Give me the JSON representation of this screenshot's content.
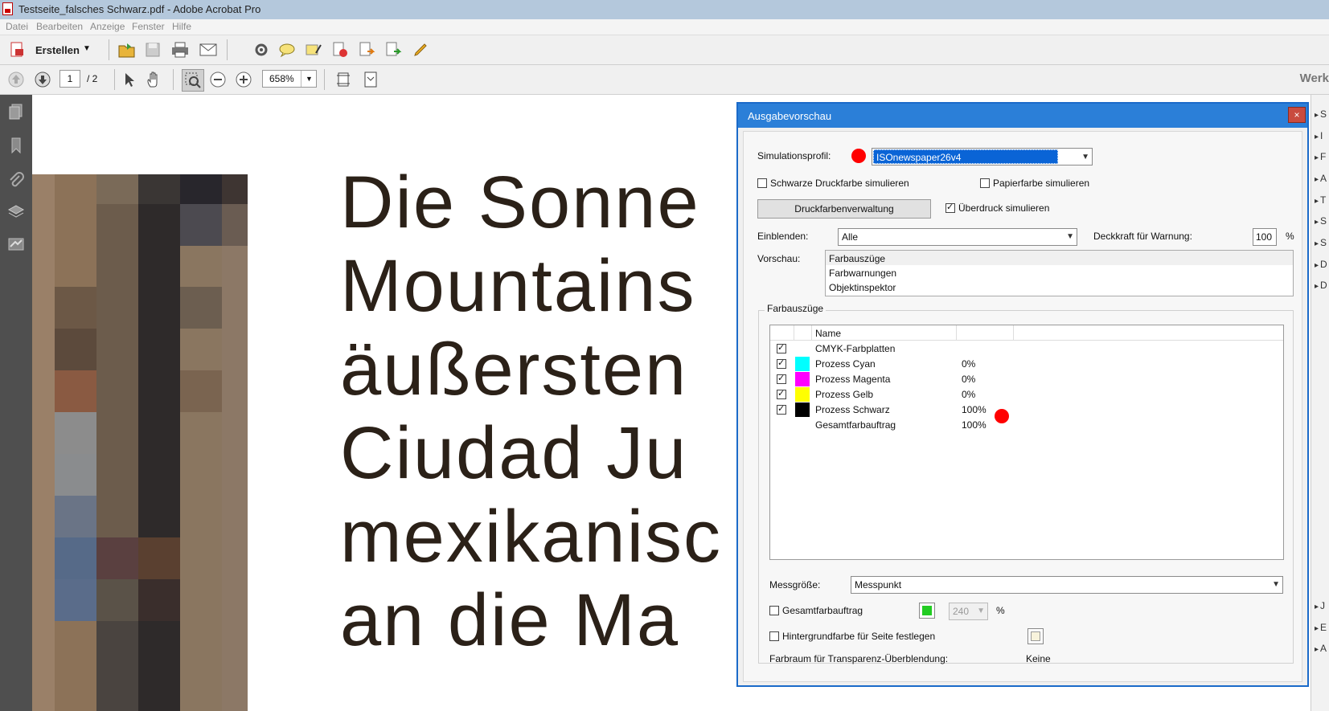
{
  "window": {
    "title": "Testseite_falsches Schwarz.pdf - Adobe Acrobat Pro"
  },
  "menu": [
    "Datei",
    "Bearbeiten",
    "Anzeige",
    "Fenster",
    "Hilfe"
  ],
  "toolbar": {
    "create_label": "Erstellen"
  },
  "navigation": {
    "current_page": "1",
    "total_pages": "/ 2",
    "zoom": "658%",
    "tools_label": "Werk"
  },
  "document": {
    "lines": [
      "Die Sonne",
      "Mountains",
      "äußersten",
      "Ciudad Ju",
      "mexikanisc",
      "an die Ma"
    ]
  },
  "right_pane_items": [
    "S",
    "I",
    "F",
    "A",
    "T",
    "S",
    "S",
    "D",
    "D",
    "J",
    "E",
    "A"
  ],
  "dialog": {
    "title": "Ausgabevorschau",
    "close": "×",
    "simulation_profile_label": "Simulationsprofil:",
    "simulation_profile_value": "ISOnewspaper26v4",
    "black_ink_label": "Schwarze Druckfarbe simulieren",
    "paper_color_label": "Papierfarbe simulieren",
    "ink_manager_button": "Druckfarbenverwaltung",
    "overprint_label": "Überdruck simulieren",
    "show_label": "Einblenden:",
    "show_value": "Alle",
    "warning_opacity_label": "Deckkraft für Warnung:",
    "warning_opacity_value": "100",
    "percent": "%",
    "preview_label": "Vorschau:",
    "preview_options": [
      "Farbauszüge",
      "Farbwarnungen",
      "Objektinspektor"
    ],
    "separations_group_label": "Farbauszüge",
    "table_header_name": "Name",
    "separations": [
      {
        "name": "CMYK-Farbplatten",
        "value": "",
        "swatch": "",
        "checked": true
      },
      {
        "name": "Prozess Cyan",
        "value": "0%",
        "swatch": "#00ffff",
        "checked": true
      },
      {
        "name": "Prozess Magenta",
        "value": "0%",
        "swatch": "#ff00ff",
        "checked": true
      },
      {
        "name": "Prozess Gelb",
        "value": "0%",
        "swatch": "#ffff00",
        "checked": true
      },
      {
        "name": "Prozess Schwarz",
        "value": "100%",
        "swatch": "#000000",
        "checked": true
      },
      {
        "name": "Gesamtfarbauftrag",
        "value": "100%",
        "swatch": "",
        "checked": false
      }
    ],
    "sample_size_label": "Messgröße:",
    "sample_size_value": "Messpunkt",
    "total_coverage_label": "Gesamtfarbauftrag",
    "total_coverage_value": "240",
    "bg_color_label": "Hintergrundfarbe für Seite festlegen",
    "blend_space_label": "Farbraum für Transparenz-Überblendung:",
    "blend_space_value": "Keine"
  },
  "colors": {
    "marker": "#ff0000",
    "dialog_title": "#2b7fd8",
    "selection": "#0a64d6",
    "text": "#2b2118"
  }
}
